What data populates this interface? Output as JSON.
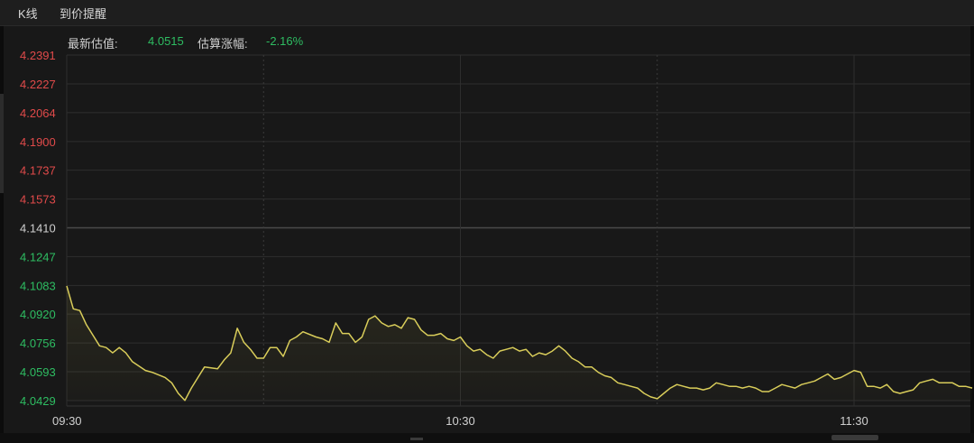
{
  "tabs": {
    "kline": "K线",
    "price_alert": "到价提醒"
  },
  "info": {
    "estimate_label": "最新估值:",
    "estimate_value": "4.0515",
    "change_label": "估算涨幅:",
    "change_value": "-2.16%"
  },
  "colors": {
    "up": "#e04a4a",
    "down": "#2ebd62",
    "neutral": "#cfcfcf",
    "line": "#d9cd5a",
    "grid": "#2e2e2e",
    "baseline": "#4a4a4a"
  },
  "chart_data": {
    "type": "line",
    "title": "",
    "xlabel": "",
    "ylabel": "",
    "base_value": 4.141,
    "ylim": [
      4.0429,
      4.2391
    ],
    "y_ticks": [
      "4.2391",
      "4.2227",
      "4.2064",
      "4.1900",
      "4.1737",
      "4.1573",
      "4.1410",
      "4.1247",
      "4.1083",
      "4.0920",
      "4.0756",
      "4.0593",
      "4.0429"
    ],
    "x_ticks": [
      "09:30",
      "10:30",
      "11:30"
    ],
    "x_range_minutes": [
      0,
      120
    ],
    "x_tick_minutes": [
      0,
      60,
      120
    ],
    "grid_minutes": [
      30,
      60,
      90,
      120
    ],
    "series": [
      {
        "x": [
          0,
          1,
          2,
          3,
          5,
          6,
          7,
          8,
          9,
          10,
          12,
          13,
          15,
          16,
          17,
          18,
          19,
          20,
          21,
          23,
          24,
          25,
          26,
          27,
          28,
          29,
          30,
          31,
          32,
          33,
          34,
          35,
          36,
          38,
          39,
          40,
          41,
          42,
          43,
          44,
          45,
          46,
          47,
          48,
          49,
          50,
          51,
          52,
          53,
          54,
          55,
          56,
          57,
          58,
          59,
          60,
          61,
          62,
          63,
          64,
          65,
          66,
          67,
          68,
          69,
          70,
          71,
          72,
          73,
          74,
          75,
          76,
          77,
          78,
          79,
          80,
          81,
          82,
          83,
          84,
          85,
          86,
          87,
          88,
          89,
          90,
          91,
          92,
          93,
          94,
          95,
          96,
          97,
          98,
          99,
          100,
          101,
          102,
          103,
          104,
          105,
          106,
          107,
          108,
          109,
          110,
          111,
          112,
          113,
          114,
          115,
          116,
          117,
          118,
          119,
          120,
          121,
          122,
          123,
          124,
          125,
          126,
          127,
          128,
          129,
          130,
          131,
          132,
          133,
          134,
          135,
          136,
          137,
          138
        ],
        "y": [
          4.108,
          4.095,
          4.094,
          4.086,
          4.074,
          4.073,
          4.07,
          4.073,
          4.07,
          4.065,
          4.06,
          4.059,
          4.056,
          4.053,
          4.047,
          4.043,
          4.05,
          4.056,
          4.062,
          4.061,
          4.066,
          4.07,
          4.084,
          4.076,
          4.072,
          4.067,
          4.067,
          4.073,
          4.073,
          4.068,
          4.077,
          4.079,
          4.082,
          4.079,
          4.078,
          4.076,
          4.087,
          4.081,
          4.081,
          4.076,
          4.079,
          4.089,
          4.091,
          4.087,
          4.085,
          4.086,
          4.084,
          4.09,
          4.089,
          4.083,
          4.08,
          4.08,
          4.081,
          4.078,
          4.077,
          4.079,
          4.074,
          4.071,
          4.072,
          4.069,
          4.067,
          4.071,
          4.072,
          4.073,
          4.071,
          4.072,
          4.068,
          4.07,
          4.069,
          4.071,
          4.074,
          4.071,
          4.067,
          4.065,
          4.062,
          4.062,
          4.059,
          4.057,
          4.056,
          4.053,
          4.052,
          4.051,
          4.05,
          4.047,
          4.045,
          4.044,
          4.047,
          4.05,
          4.052,
          4.051,
          4.05,
          4.05,
          4.049,
          4.05,
          4.053,
          4.052,
          4.051,
          4.051,
          4.05,
          4.051,
          4.05,
          4.048,
          4.048,
          4.05,
          4.052,
          4.051,
          4.05,
          4.052,
          4.053,
          4.054,
          4.056,
          4.058,
          4.055,
          4.056,
          4.058,
          4.06,
          4.059,
          4.051,
          4.051,
          4.05,
          4.052,
          4.048,
          4.047,
          4.048,
          4.049,
          4.053,
          4.054,
          4.055,
          4.053,
          4.053,
          4.053,
          4.051,
          4.051,
          4.05
        ]
      }
    ]
  }
}
